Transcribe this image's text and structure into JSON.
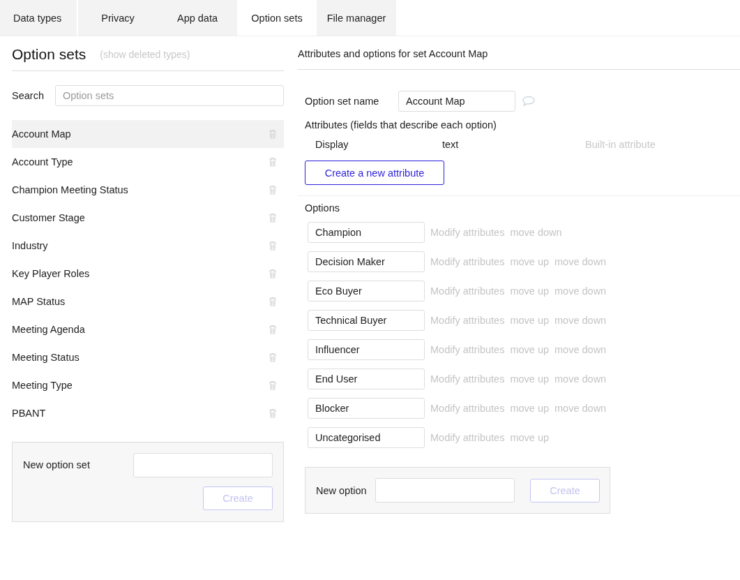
{
  "tabs": [
    {
      "label": "Data types",
      "selected": false
    },
    {
      "label": "Privacy",
      "selected": false
    },
    {
      "label": "App data",
      "selected": false
    },
    {
      "label": "Option sets",
      "selected": true
    },
    {
      "label": "File manager",
      "selected": false
    }
  ],
  "sidebar": {
    "title": "Option sets",
    "deleted_link": "(show deleted types)",
    "search_label": "Search",
    "search": {
      "placeholder": "Option sets"
    },
    "items": [
      {
        "label": "Account Map",
        "selected": true
      },
      {
        "label": "Account Type",
        "selected": false
      },
      {
        "label": "Champion Meeting Status",
        "selected": false
      },
      {
        "label": "Customer Stage",
        "selected": false
      },
      {
        "label": "Industry",
        "selected": false
      },
      {
        "label": "Key Player Roles",
        "selected": false
      },
      {
        "label": "MAP Status",
        "selected": false
      },
      {
        "label": "Meeting Agenda",
        "selected": false
      },
      {
        "label": "Meeting Status",
        "selected": false
      },
      {
        "label": "Meeting Type",
        "selected": false
      },
      {
        "label": "PBANT",
        "selected": false
      }
    ],
    "new_set": {
      "label": "New option set",
      "button": "Create",
      "disabled": true
    }
  },
  "detail": {
    "heading": "Attributes and options for set Account Map",
    "name_label": "Option set name",
    "name_value": "Account Map",
    "attributes_label": "Attributes (fields that describe each option)",
    "attributes": [
      {
        "name": "Display",
        "type": "text",
        "note": "Built-in attribute"
      }
    ],
    "create_attribute": "Create a new attribute",
    "options_label": "Options",
    "options": [
      {
        "value": "Champion",
        "actions": [
          "Modify attributes",
          "move down"
        ]
      },
      {
        "value": "Decision Maker",
        "actions": [
          "Modify attributes",
          "move up",
          "move down"
        ]
      },
      {
        "value": "Eco Buyer",
        "actions": [
          "Modify attributes",
          "move up",
          "move down"
        ]
      },
      {
        "value": "Technical Buyer",
        "actions": [
          "Modify attributes",
          "move up",
          "move down"
        ]
      },
      {
        "value": "Influencer",
        "actions": [
          "Modify attributes",
          "move up",
          "move down"
        ]
      },
      {
        "value": "End User",
        "actions": [
          "Modify attributes",
          "move up",
          "move down"
        ]
      },
      {
        "value": "Blocker",
        "actions": [
          "Modify attributes",
          "move up",
          "move down"
        ]
      },
      {
        "value": "Uncategorised",
        "actions": [
          "Modify attributes",
          "move up"
        ]
      }
    ],
    "new_option": {
      "label": "New option",
      "button": "Create",
      "disabled": true
    }
  }
}
